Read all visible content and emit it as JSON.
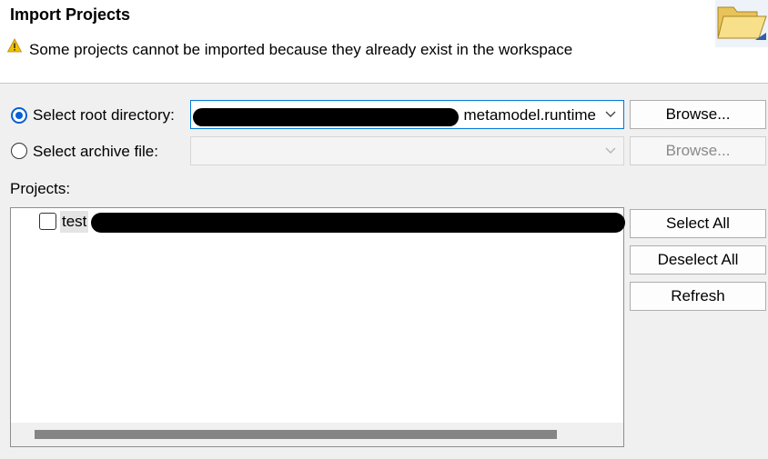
{
  "header": {
    "title": "Import Projects",
    "warning_icon": "warning-icon",
    "warning_text": "Some projects cannot be imported because they already exist in the workspace",
    "banner_icon": "folder-icon"
  },
  "source": {
    "root_directory": {
      "label": "Select root directory:",
      "selected": true,
      "value_visible_suffix": "metamodel.runtime",
      "browse_label": "Browse..."
    },
    "archive_file": {
      "label": "Select archive file:",
      "selected": false,
      "value": "",
      "browse_label": "Browse..."
    }
  },
  "projects": {
    "label": "Projects:",
    "items": [
      {
        "label": "test",
        "checked": false
      }
    ],
    "buttons": {
      "select_all": "Select All",
      "deselect_all": "Deselect All",
      "refresh": "Refresh"
    }
  },
  "colors": {
    "accent": "#0a5fd4",
    "focus_border": "#0078d7",
    "warning": "#f2c200"
  }
}
